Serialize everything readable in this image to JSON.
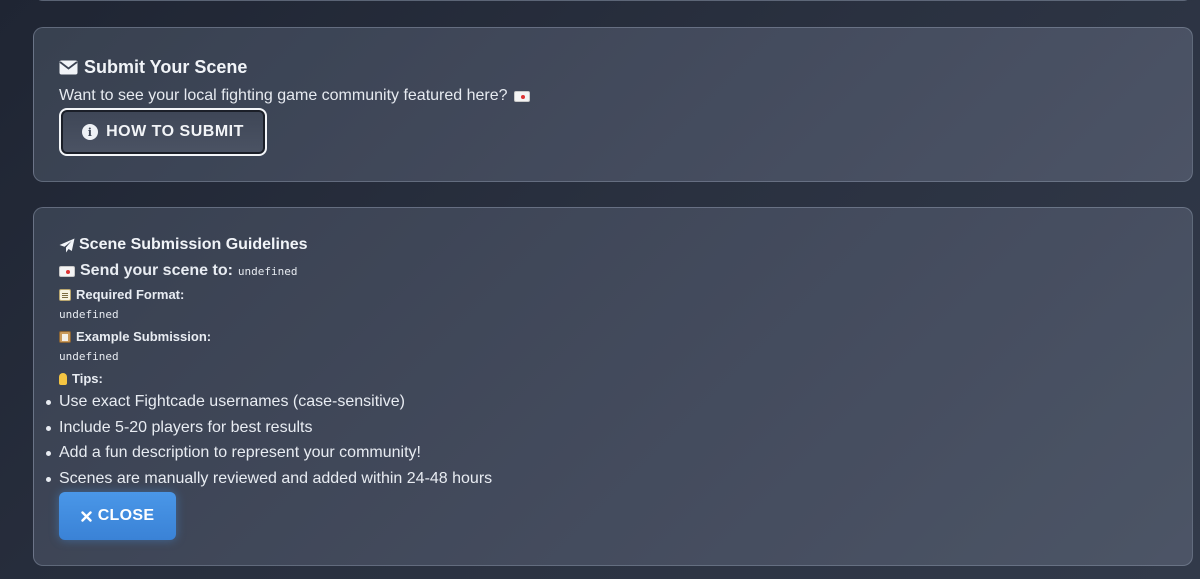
{
  "submit_card": {
    "title": "Submit Your Scene",
    "description": "Want to see your local fighting game community featured here?",
    "how_button_label": "HOW TO SUBMIT"
  },
  "guidelines": {
    "title": "Scene Submission Guidelines",
    "send_label": "Send your scene to:",
    "send_value": "undefined",
    "required_format_label": "Required Format:",
    "required_format_value": "undefined",
    "example_label": "Example Submission:",
    "example_value": "undefined",
    "tips_label": "Tips:",
    "tips": [
      "Use exact Fightcade usernames (case-sensitive)",
      "Include 5-20 players for best results",
      "Add a fun description to represent your community!",
      "Scenes are manually reviewed and added within 24-48 hours"
    ],
    "close_button_label": "CLOSE"
  },
  "icons": {
    "envelope": "envelope-icon",
    "info": "info-icon",
    "paper_plane": "paper-plane-icon",
    "close": "close-icon"
  },
  "colors": {
    "accent_blue": "#4a97e8",
    "card_border": "#8e98aa",
    "text": "#e8ecf2"
  }
}
